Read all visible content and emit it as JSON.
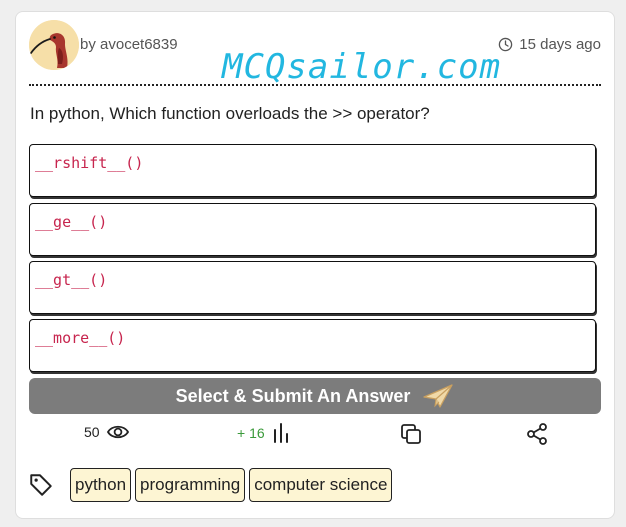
{
  "post": {
    "author": "by avocet6839",
    "watermark": "MCQsailor.com",
    "time_ago": "15 days ago"
  },
  "question": {
    "text": "In python, Which function overloads the >> operator?"
  },
  "options": [
    {
      "label": "__rshift__()"
    },
    {
      "label": "__ge__()"
    },
    {
      "label": "__gt__()"
    },
    {
      "label": "__more__()"
    }
  ],
  "submit": {
    "label": "Select & Submit An Answer"
  },
  "stats": {
    "views": "50",
    "votes": "+ 16"
  },
  "tags": [
    {
      "label": "python"
    },
    {
      "label": "programming"
    },
    {
      "label": "computer science"
    }
  ],
  "icons": {
    "time": "clock-icon",
    "views": "eye-icon",
    "votes": "bar-chart-icon",
    "copy": "copy-icon",
    "share": "share-icon",
    "tag": "tag-icon",
    "submit": "paper-plane-icon"
  },
  "colors": {
    "watermark": "#22b7e0",
    "code": "#c7254e",
    "submit_bg": "#7c7c7c",
    "votes": "#3a9a3a",
    "tag_bg": "#fdf5d3"
  }
}
